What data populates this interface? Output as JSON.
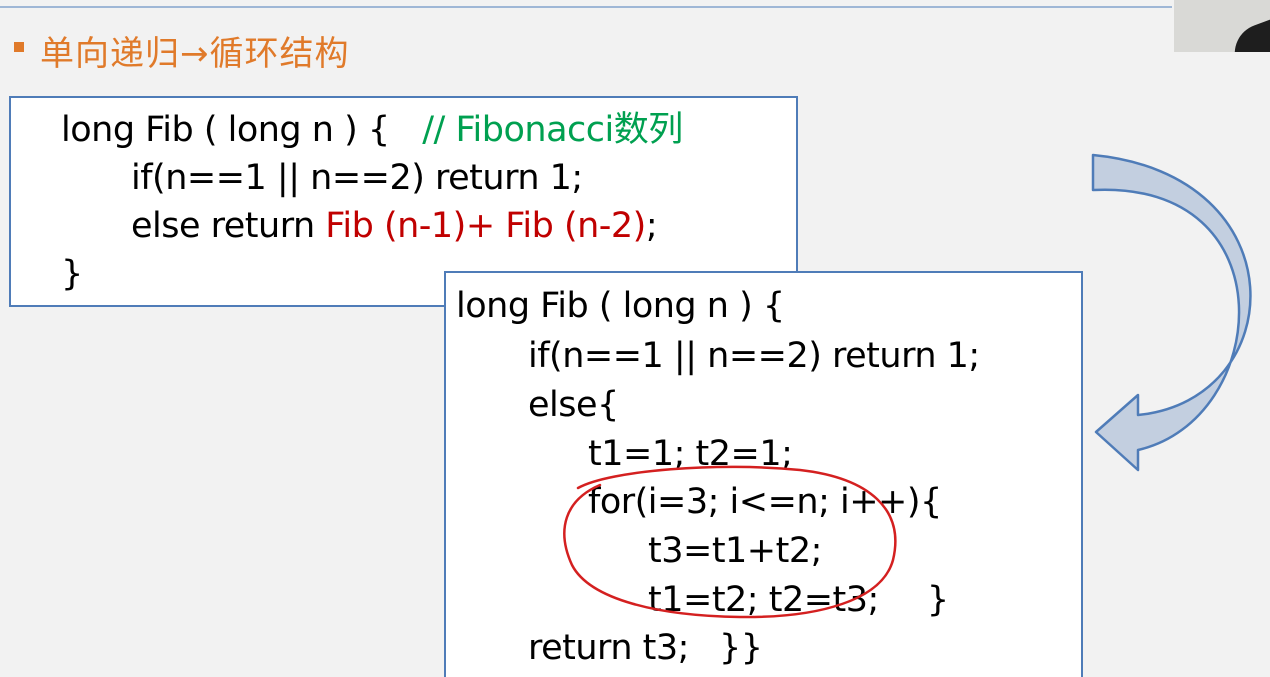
{
  "header": {
    "title": "单向递归→循环结构"
  },
  "recursive_code": {
    "line1": "long Fib ( long n ) {",
    "comment": "// Fibonacci数列",
    "line2": "if(n==1 || n==2) return 1;",
    "line3_prefix": "else return ",
    "line3_red": "Fib (n-1)+ Fib (n-2)",
    "line3_suffix": ";",
    "line4": "}"
  },
  "loop_code": {
    "line1": "long Fib ( long n ) {",
    "line2": "if(n==1 || n==2) return 1;",
    "line3": "else{",
    "line4": "t1=1; t2=1;",
    "line5": "for(i=3; i<=n; i++){",
    "line6": "t3=t1+t2;",
    "line7": "t1=t2; t2=t3;",
    "line7_brace": "}",
    "line8": "return t3;",
    "line8_brace": "}}"
  },
  "colors": {
    "accent_orange": "#e07a2a",
    "box_border": "#4f7cb8",
    "highlight_red": "#c00000",
    "comment_green": "#00a050",
    "annotation_red": "#d42020"
  },
  "icons": {
    "arrow": "curved-arrow-icon",
    "annotation": "hand-drawn-circle"
  }
}
